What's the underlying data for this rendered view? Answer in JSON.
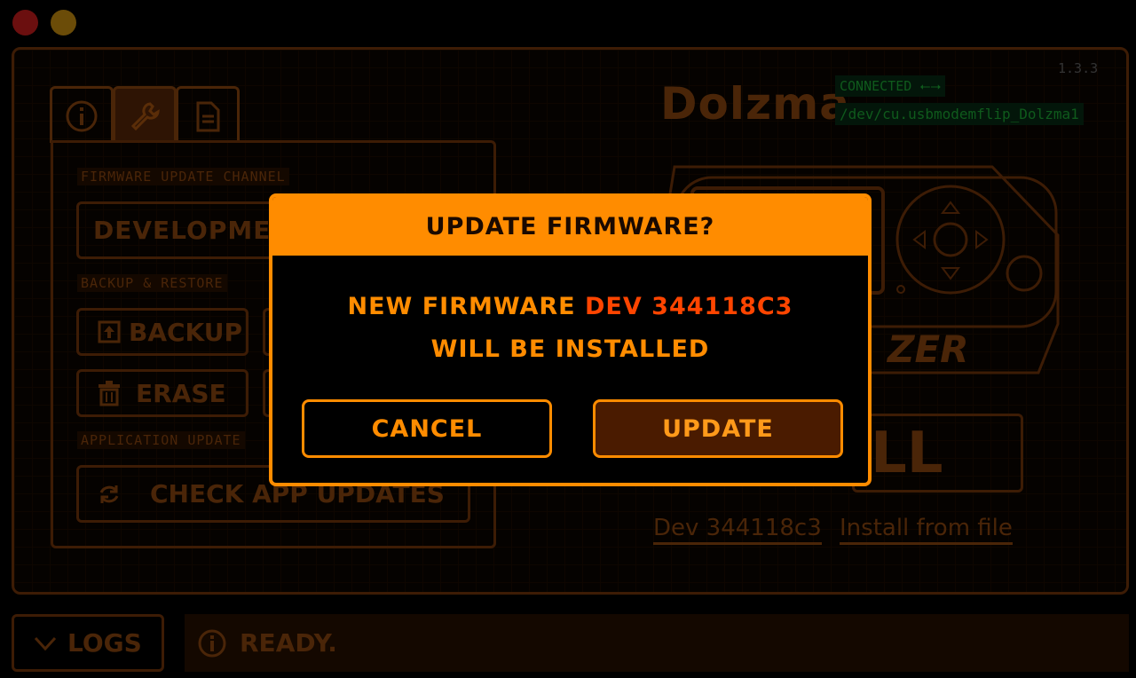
{
  "window": {
    "close_color": "#6b0f0f",
    "minimize_color": "#6b4c08"
  },
  "header": {
    "app_name": "Dolzma",
    "version": "1.3.3",
    "connection_status": "CONNECTED",
    "connection_icon": "usb-icon",
    "port": "/dev/cu.usbmodemflip_Dolzma1"
  },
  "tabs": [
    {
      "name": "info",
      "icon": "info-icon"
    },
    {
      "name": "tools",
      "icon": "wrench-icon",
      "active": true
    },
    {
      "name": "files",
      "icon": "file-icon"
    }
  ],
  "settings": {
    "firmware_channel_label": "FIRMWARE UPDATE CHANNEL",
    "firmware_channel_value": "DEVELOPMEN",
    "backup_restore_label": "BACKUP & RESTORE",
    "backup_label": "BACKUP",
    "erase_label": "ERASE",
    "application_update_label": "APPLICATION UPDATE",
    "check_updates_label": "CHECK APP UPDATES"
  },
  "device": {
    "brand_fragment": "ZER",
    "install_fragment": "LL",
    "dev_link": "Dev 344118c3",
    "install_from_file": "Install from file"
  },
  "footer": {
    "logs_label": "LOGS",
    "status_text": "READY."
  },
  "modal": {
    "title": "UPDATE FIRMWARE?",
    "line1_prefix": "NEW FIRMWARE ",
    "line1_version": "DEV 344118C3",
    "line2": "WILL BE INSTALLED",
    "cancel_label": "CANCEL",
    "update_label": "UPDATE"
  },
  "colors": {
    "accent": "#ff8c00",
    "highlight": "#ff4500",
    "connected": "#0f5a1c",
    "background": "#000000"
  }
}
